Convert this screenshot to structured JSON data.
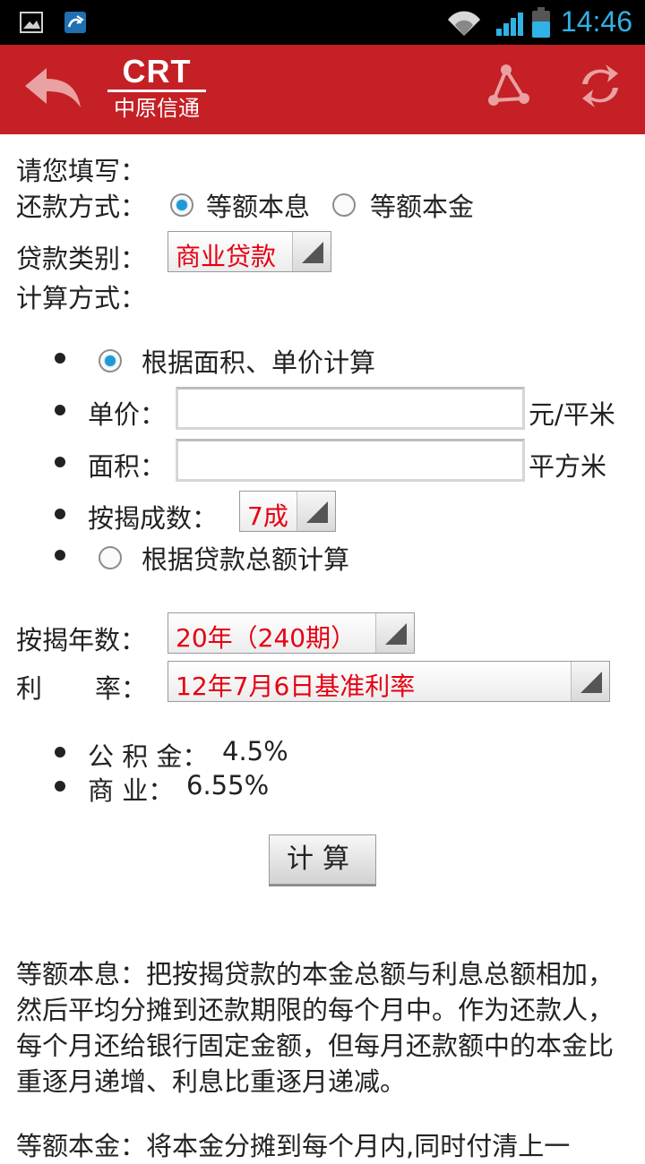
{
  "status_bar": {
    "time": "14:46"
  },
  "header": {
    "logo_main": "CRT",
    "logo_sub": "中原信通"
  },
  "form": {
    "intro": "请您填写：",
    "repay_label": "还款方式：",
    "repay_options": [
      "等额本息",
      "等额本金"
    ],
    "loan_type_label": "贷款类别：",
    "loan_type_value": "商业贷款",
    "calc_method_label": "计算方式：",
    "method_area_label": "根据面积、单价计算",
    "unit_price_label": "单价：",
    "unit_price_value": "",
    "unit_price_unit": "元/平米",
    "area_label": "面积：",
    "area_value": "",
    "area_unit": "平方米",
    "mortgage_ratio_label": "按揭成数：",
    "mortgage_ratio_value": "7成",
    "method_total_label": "根据贷款总额计算",
    "years_label": "按揭年数：",
    "years_value": "20年（240期）",
    "rate_label_1": "利",
    "rate_label_2": "率：",
    "rate_value": "12年7月6日基准利率",
    "rate_fund_label": "公 积 金：",
    "rate_fund_value": "4.5%",
    "rate_commercial_label": "商 业：",
    "rate_commercial_value": "6.55%",
    "calc_button": "计算"
  },
  "notes": {
    "equal_installment": "等额本息：把按揭贷款的本金总额与利息总额相加，然后平均分摊到还款期限的每个月中。作为还款人，每个月还给银行固定金额，但每月还款额中的本金比重逐月递增、利息比重逐月递减。",
    "equal_principal": "等额本金：将本金分摊到每个月内,同时付清上一"
  },
  "colors": {
    "header_red": "#c42025",
    "select_value_red": "#e60012",
    "status_blue": "#2fb2e6"
  }
}
